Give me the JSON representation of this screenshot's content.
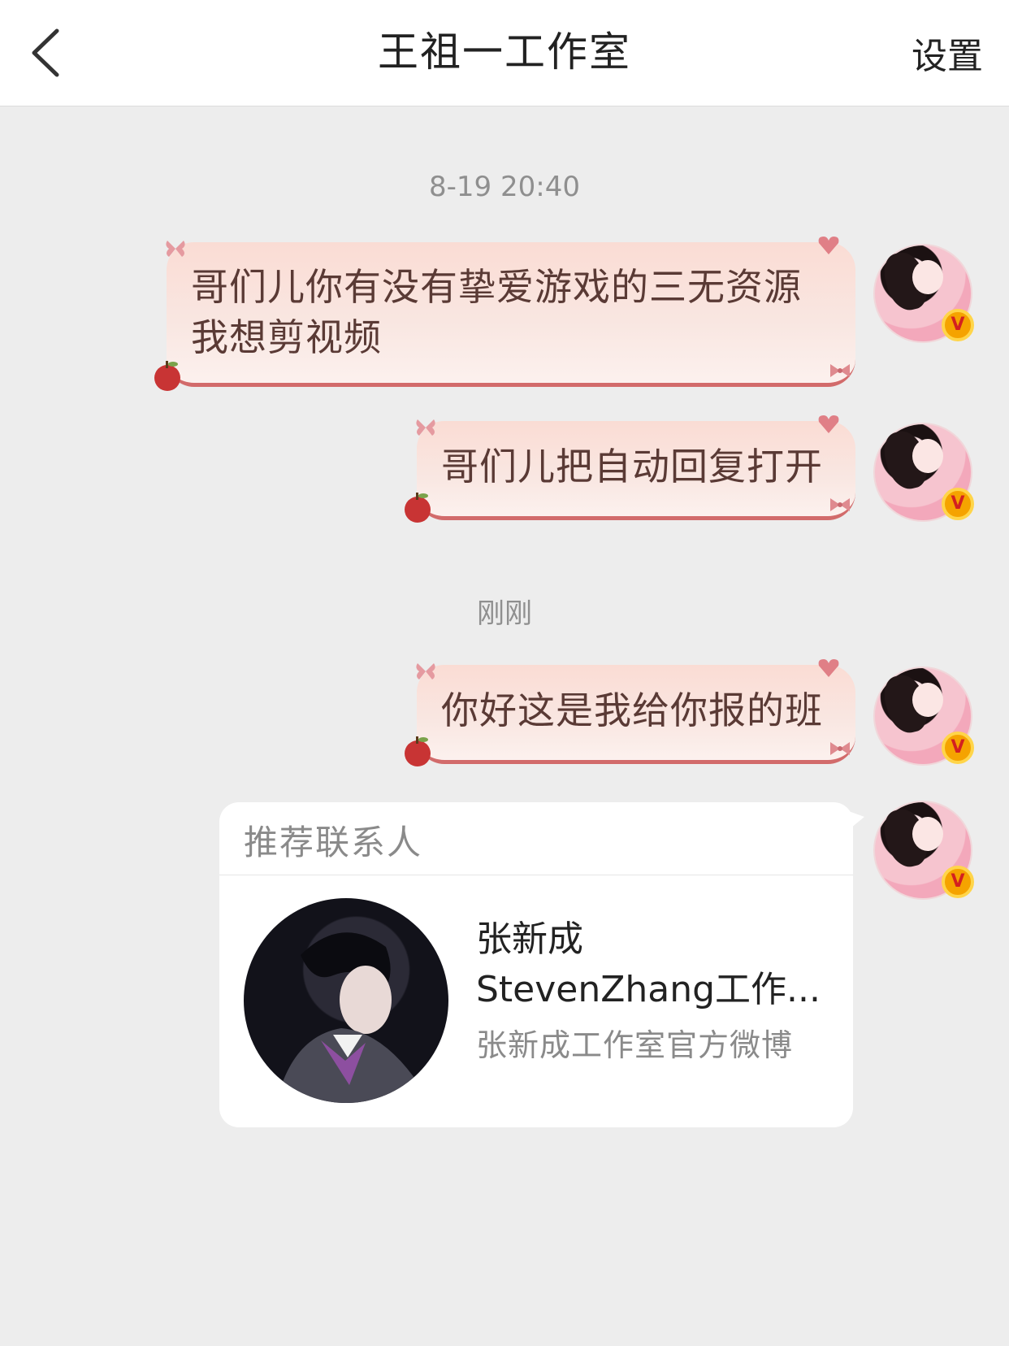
{
  "header": {
    "title": "王祖一工作室",
    "settings_label": "设置",
    "back_icon": "chevron-left"
  },
  "colors": {
    "bubble_text": "#5a3a35",
    "bubble_border": "#d26b6b",
    "background": "#ededed",
    "verified_badge": "#f5a300"
  },
  "conversation": {
    "timestamps": [
      "8-19 20:40",
      "刚刚"
    ],
    "messages": [
      {
        "text_line1": "哥们儿你有没有挚爱游戏的三无资源",
        "text_line2": "我想剪视频"
      },
      {
        "text": "哥们儿把自动回复打开"
      },
      {
        "text": "你好这是我给你报的班"
      }
    ],
    "avatar_badge": "V"
  },
  "contact_card": {
    "header": "推荐联系人",
    "name_line1": "张新成",
    "name_line2": "StevenZhang工作...",
    "description": "张新成工作室官方微博"
  }
}
